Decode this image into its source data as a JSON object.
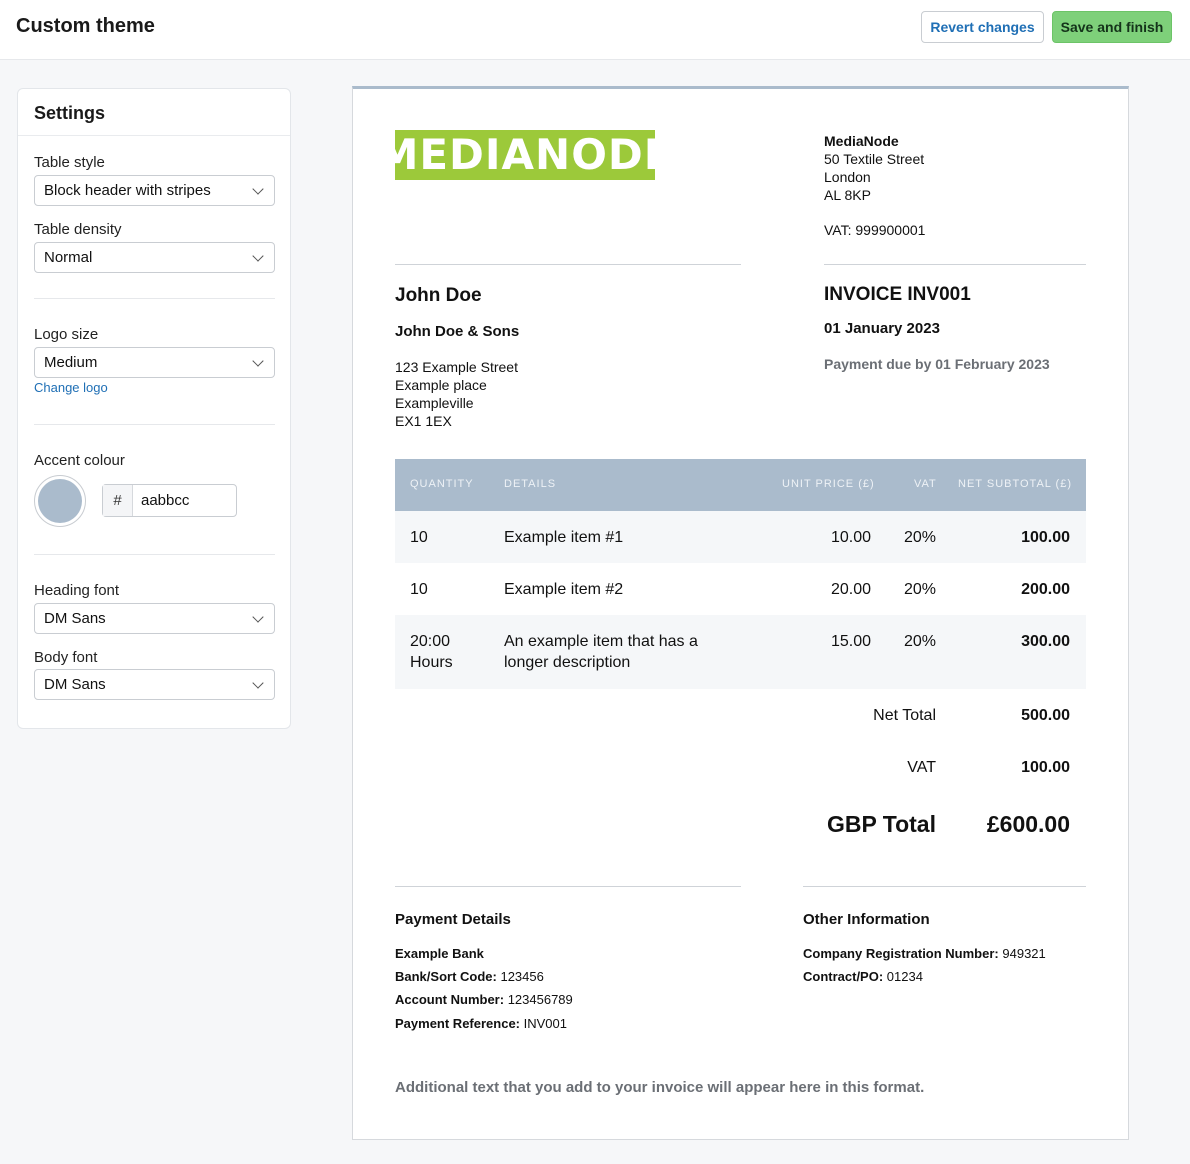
{
  "topbar": {
    "title": "Custom theme",
    "revert_label": "Revert changes",
    "save_label": "Save and finish"
  },
  "settings": {
    "title": "Settings",
    "table_style": {
      "label": "Table style",
      "value": "Block header with stripes"
    },
    "table_density": {
      "label": "Table density",
      "value": "Normal"
    },
    "logo_size": {
      "label": "Logo size",
      "value": "Medium",
      "change_link": "Change logo"
    },
    "accent": {
      "label": "Accent colour",
      "prefix": "#",
      "value": "aabbcc",
      "color": "#aabbcc"
    },
    "heading_font": {
      "label": "Heading font",
      "value": "DM Sans"
    },
    "body_font": {
      "label": "Body font",
      "value": "DM Sans"
    }
  },
  "invoice": {
    "logo_text": "MEDIANODE",
    "logo_color": "#9cc93a",
    "seller": {
      "name": "MediaNode",
      "address": [
        "50 Textile Street",
        "London",
        "AL 8KP"
      ],
      "vat": "VAT: 999900001"
    },
    "customer": {
      "name": "John Doe",
      "company": "John Doe & Sons",
      "address": [
        "123 Example Street",
        "Example place",
        "Exampleville",
        "EX1 1EX"
      ]
    },
    "meta": {
      "title": "INVOICE INV001",
      "date": "01 January 2023",
      "due": "Payment due by 01 February 2023"
    },
    "table": {
      "headers": [
        "QUANTITY",
        "DETAILS",
        "UNIT PRICE (£)",
        "VAT",
        "NET SUBTOTAL (£)"
      ],
      "rows": [
        {
          "qty": "10",
          "details": "Example item #1",
          "details2": "",
          "qty2": "",
          "unit": "10.00",
          "vat": "20%",
          "subtotal": "100.00"
        },
        {
          "qty": "10",
          "details": "Example item #2",
          "details2": "",
          "qty2": "",
          "unit": "20.00",
          "vat": "20%",
          "subtotal": "200.00"
        },
        {
          "qty": "20:00",
          "qty2": "Hours",
          "details": "An example item that has a",
          "details2": "longer description",
          "unit": "15.00",
          "vat": "20%",
          "subtotal": "300.00"
        }
      ]
    },
    "totals": {
      "net_label": "Net Total",
      "net_value": "500.00",
      "vat_label": "VAT",
      "vat_value": "100.00",
      "grand_label": "GBP Total",
      "grand_value": "£600.00"
    },
    "payment": {
      "title": "Payment Details",
      "bank": "Example Bank",
      "sort_label": "Bank/Sort Code:",
      "sort_value": "123456",
      "account_label": "Account Number:",
      "account_value": "123456789",
      "ref_label": "Payment Reference:",
      "ref_value": "INV001"
    },
    "other": {
      "title": "Other Information",
      "reg_label": "Company Registration Number:",
      "reg_value": "949321",
      "po_label": "Contract/PO:",
      "po_value": "01234"
    },
    "footer_text": "Additional text that you add to your invoice will appear here in this format."
  }
}
